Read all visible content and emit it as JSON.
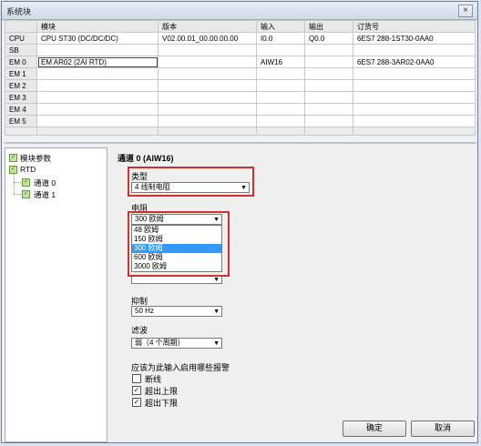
{
  "window": {
    "title": "系统块",
    "close_glyph": "×"
  },
  "grid": {
    "headers": [
      "模块",
      "版本",
      "输入",
      "输出",
      "订货号"
    ],
    "rows": [
      {
        "slot": "CPU",
        "module": "CPU ST30 (DC/DC/DC)",
        "version": "V02.00.01_00.00.00.00",
        "input": "I0.0",
        "output": "Q0.0",
        "order": "6ES7 288-1ST30-0AA0"
      },
      {
        "slot": "SB",
        "module": "",
        "version": "",
        "input": "",
        "output": "",
        "order": ""
      },
      {
        "slot": "EM 0",
        "module": "EM AR02 (2AI RTD)",
        "version": "",
        "input": "AIW16",
        "output": "",
        "order": "6ES7 288-3AR02-0AA0"
      },
      {
        "slot": "EM 1",
        "module": "",
        "version": "",
        "input": "",
        "output": "",
        "order": ""
      },
      {
        "slot": "EM 2",
        "module": "",
        "version": "",
        "input": "",
        "output": "",
        "order": ""
      },
      {
        "slot": "EM 3",
        "module": "",
        "version": "",
        "input": "",
        "output": "",
        "order": ""
      },
      {
        "slot": "EM 4",
        "module": "",
        "version": "",
        "input": "",
        "output": "",
        "order": ""
      },
      {
        "slot": "EM 5",
        "module": "",
        "version": "",
        "input": "",
        "output": "",
        "order": ""
      }
    ]
  },
  "tree": {
    "items": [
      {
        "label": "模块参数"
      },
      {
        "label": "RTD"
      },
      {
        "label": "通道 0"
      },
      {
        "label": "通道 1"
      }
    ]
  },
  "panel": {
    "title": "通道 0 (AIW16)",
    "type_label": "类型",
    "type_value": "4 线制电阻",
    "resistance_label": "电阻",
    "resistance_value": "300 欧姆",
    "resistance_options": [
      "48 欧姆",
      "150 欧姆",
      "300 欧姆",
      "600 欧姆",
      "3000 欧姆"
    ],
    "suppress_label": "抑制",
    "suppress_value": "50 Hz",
    "filter_label": "滤波",
    "filter_value": "弱（4 个周期）",
    "alarm_label": "应该为此输入启用哪些报警",
    "alarms": [
      {
        "label": "断线",
        "checked": false
      },
      {
        "label": "超出上限",
        "checked": true
      },
      {
        "label": "超出下限",
        "checked": true
      }
    ],
    "dropdown_glyph": "▼",
    "check_glyph": "✓"
  },
  "buttons": {
    "ok": "确定",
    "cancel": "取消"
  }
}
